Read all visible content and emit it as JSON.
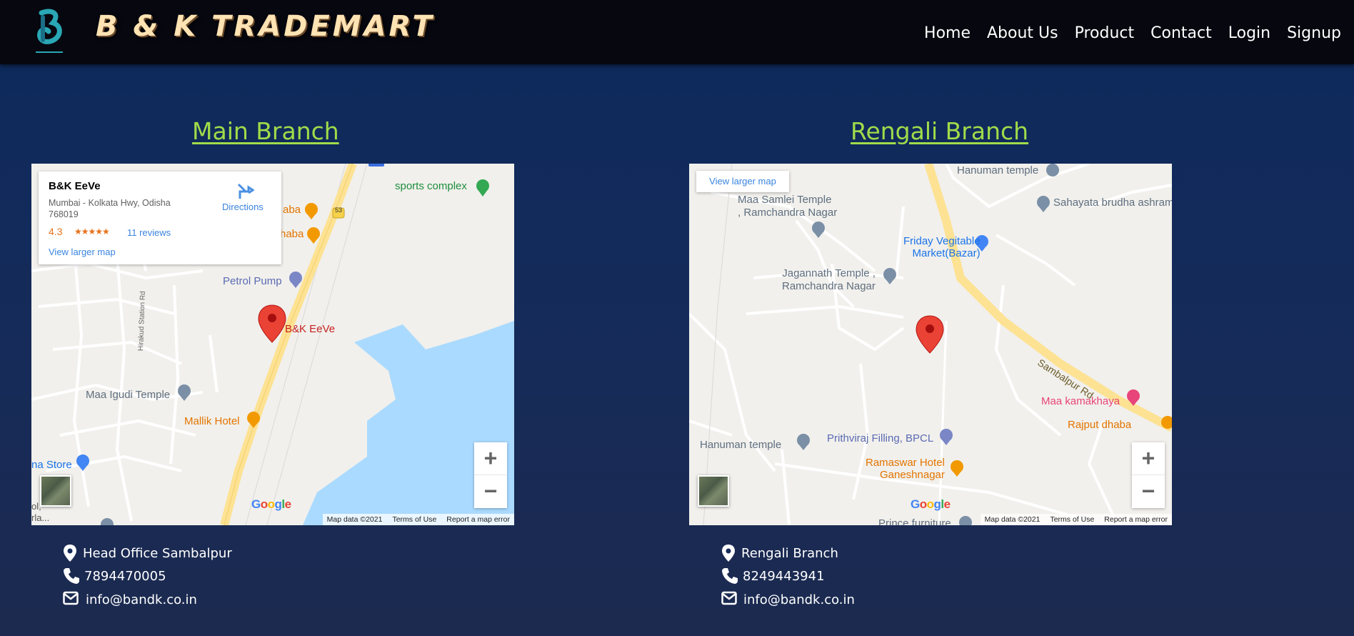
{
  "header": {
    "brand": "B & K TRADEMART",
    "logo_icon": "bk-logo-icon",
    "nav": [
      "Home",
      "About Us",
      "Product",
      "Contact",
      "Login",
      "Signup"
    ]
  },
  "branches": [
    {
      "title": "Main Branch",
      "map": {
        "card": {
          "name": "B&K EeVe",
          "address": "Mumbai - Kolkata Hwy, Odisha 768019",
          "rating": "4.3",
          "stars": "★★★★★",
          "reviews": "11 reviews",
          "directions": "Directions",
          "larger": "View larger map"
        },
        "labels": {
          "sports": "sports complex",
          "petrol": "Petrol Pump",
          "marker": "B&K EeVe",
          "temple": "Maa Igudi Temple",
          "hotel": "Mallik Hotel",
          "store": "na Store",
          "road53": "53",
          "road_name": "Hirakud Station Rd",
          "dhaba1": "aba",
          "dhaba2": "haba",
          "partial1": "ol,",
          "partial2": "rla..."
        },
        "google": "Google",
        "footer": [
          "Map data ©2021",
          "Terms of Use",
          "Report a map error"
        ]
      },
      "contacts": {
        "location": "Head Office Sambalpur",
        "phone": "7894470005",
        "email": "info@bandk.co.in"
      }
    },
    {
      "title": "Rengali Branch",
      "map": {
        "larger": "View larger map",
        "labels": {
          "hanuman_top": "Hanuman temple",
          "sahayata": "Sahayata brudha ashram",
          "samlei": "Maa Samlei Temple\n, Ramchandra Nagar",
          "friday": "Friday Vegitable\nMarket(Bazar)",
          "jagannath": "Jagannath Temple ,\nRamchandra Nagar",
          "sambalpur_rd": "Sambalpur Rd",
          "kamakhaya": "Maa kamakhaya",
          "rajput": "Rajput dhaba",
          "hanuman_bottom": "Hanuman temple",
          "prithviraj": "Prithviraj Filling, BPCL",
          "ramaswar": "Ramaswar Hotel\nGaneshnagar",
          "prince": "Prince furniture"
        },
        "google": "Google",
        "footer": [
          "Map data ©2021",
          "Terms of Use",
          "Report a map error"
        ]
      },
      "contacts": {
        "location": "Rengali Branch",
        "phone": "8249443941",
        "email": "info@bandk.co.in"
      }
    }
  ],
  "colors": {
    "header_bg": "#06070f",
    "brand": "#ffe3b3",
    "branch_title": "#9fdc4a",
    "map_link": "#3a84df",
    "marker": "#ea4335",
    "water": "#aadaff",
    "highway": "#fde293"
  },
  "icons": {
    "location": "map-marker-icon",
    "phone": "phone-icon",
    "email": "envelope-icon"
  }
}
